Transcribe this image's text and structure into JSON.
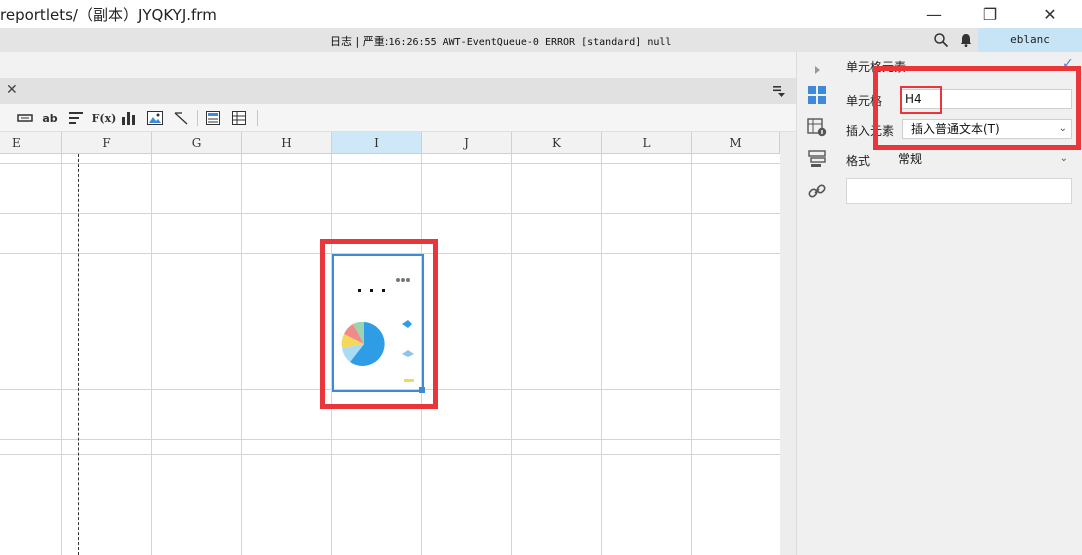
{
  "window": {
    "title": "reportlets/（副本）JYQKYJ.frm",
    "minimize_glyph": "—",
    "restore_glyph": "❐",
    "close_glyph": "✕"
  },
  "logbar": {
    "label_log": "日志",
    "separator": "|",
    "label_severity": "严重:",
    "message": "16:26:55 AWT-EventQueue-0 ERROR [standard] null",
    "user": "eblanc"
  },
  "tabbar": {
    "close_glyph": "✕"
  },
  "toolbar": {
    "items": [
      {
        "name": "insert-row-icon",
        "glyph": "▬"
      },
      {
        "name": "text-icon",
        "glyph": "ab"
      },
      {
        "name": "align-icon",
        "glyph": "≡"
      },
      {
        "name": "formula-icon",
        "glyph": "F(x)"
      },
      {
        "name": "chart-icon",
        "glyph": "▮"
      },
      {
        "name": "image-icon",
        "glyph": "▣"
      },
      {
        "name": "slash-icon",
        "glyph": "⟋"
      },
      {
        "name": "report-icon",
        "glyph": "▤"
      },
      {
        "name": "table-icon",
        "glyph": "▦"
      }
    ]
  },
  "sheet": {
    "columns": [
      "E",
      "F",
      "G",
      "H",
      "I",
      "J",
      "K",
      "L",
      "M"
    ],
    "selected_column": "I",
    "cell_content": "chart-thumbnail",
    "chart_dots": "• • •"
  },
  "panel": {
    "title": "单元格元素",
    "cell_label": "单元格",
    "cell_value": "H4",
    "insert_label": "插入元素",
    "insert_value": "插入普通文本(T)",
    "format_label": "格式",
    "format_value": "常规",
    "chevron": "⌄",
    "check": "✓"
  },
  "colors": {
    "accent": "#3d8bd8",
    "highlight_red": "#e8363a",
    "user_badge": "#c6e4f5",
    "selected_col": "#cfe8f7"
  }
}
